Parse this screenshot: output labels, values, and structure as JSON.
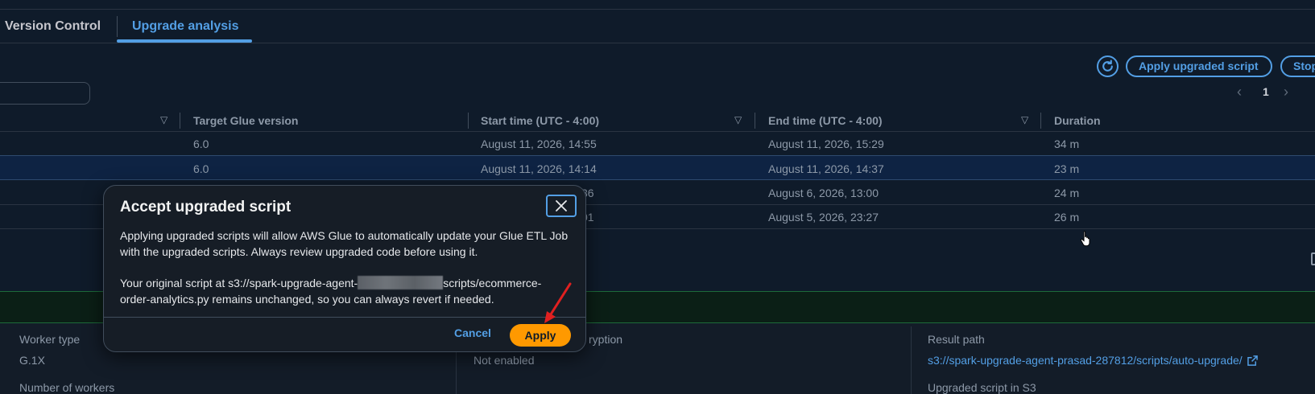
{
  "tabs": [
    {
      "label": "Version Control"
    },
    {
      "label": "Upgrade analysis",
      "active": true
    }
  ],
  "toolbar": {
    "apply_upgraded_label": "Apply upgraded script",
    "stop_label": "Stop"
  },
  "pagination": {
    "current_page": "1"
  },
  "table": {
    "columns": [
      "Target Glue version",
      "Start time (UTC - 4:00)",
      "End time (UTC - 4:00)",
      "Duration"
    ],
    "rows": [
      {
        "target": "6.0",
        "start": "August 11, 2026, 14:55",
        "end": "August 11, 2026, 15:29",
        "duration": "34 m",
        "selected": false
      },
      {
        "target": "6.0",
        "start": "August 11, 2026, 14:14",
        "end": "August 11, 2026, 14:37",
        "duration": "23 m",
        "selected": true
      },
      {
        "target": "",
        "start": "36",
        "end": "August 6, 2026, 13:00",
        "duration": "24 m",
        "selected": false
      },
      {
        "target": "",
        "start": "01",
        "end": "August 5, 2026, 23:27",
        "duration": "26 m",
        "selected": false
      }
    ]
  },
  "details": {
    "worker_type_label": "Worker type",
    "worker_type_value": "G.1X",
    "number_of_workers_label": "Number of workers",
    "encryption_label_partial": "ryption",
    "encryption_value": "Not enabled",
    "result_path_label": "Result path",
    "result_path_value": "s3://spark-upgrade-agent-prasad-287812/scripts/auto-upgrade/",
    "upgraded_script_label": "Upgraded script in S3"
  },
  "modal": {
    "title": "Accept upgraded script",
    "paragraph1": "Applying upgraded scripts will allow AWS Glue to automatically update your Glue ETL Job with the upgraded scripts. Always review upgraded code before using it.",
    "paragraph2_prefix": "Your original script at s3://spark-upgrade-agent-",
    "paragraph2_suffix": "scripts/ecommerce-order-analytics.py remains unchanged, so you can always revert if needed.",
    "cancel_label": "Cancel",
    "apply_label": "Apply"
  },
  "colors": {
    "accent": "#539fe5",
    "primary_button": "#ff9900",
    "background": "#0f1b2a",
    "annotation_arrow": "#e02020"
  }
}
